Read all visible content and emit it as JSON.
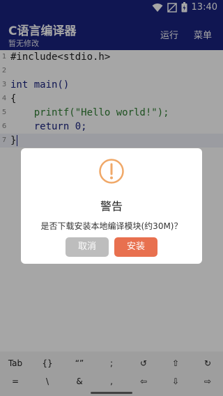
{
  "status": {
    "time": "13:40"
  },
  "header": {
    "title": "C语言编译器",
    "subtitle": "暂无修改",
    "run_label": "运行",
    "menu_label": "菜单"
  },
  "editor": {
    "lines": [
      {
        "num": "1",
        "text": "#include<stdio.h>"
      },
      {
        "num": "2",
        "text": ""
      },
      {
        "num": "3",
        "text": "int main()"
      },
      {
        "num": "4",
        "text": "{"
      },
      {
        "num": "5",
        "text": "    printf(\"Hello world!\");"
      },
      {
        "num": "6",
        "text": "    return 0;"
      },
      {
        "num": "7",
        "text": "}"
      }
    ]
  },
  "dialog": {
    "title": "警告",
    "message": "是否下载安装本地编译模块(约30M)？",
    "cancel_label": "取消",
    "install_label": "安装",
    "accent": "#e8704f",
    "icon_color": "#f0a868"
  },
  "keys": {
    "row1": [
      "Tab",
      "{}",
      "“”",
      ";",
      "↺",
      "⇧",
      "↻"
    ],
    "row2": [
      "=",
      "\\",
      "&",
      ",",
      "⇦",
      "⇩",
      "⇨"
    ]
  }
}
